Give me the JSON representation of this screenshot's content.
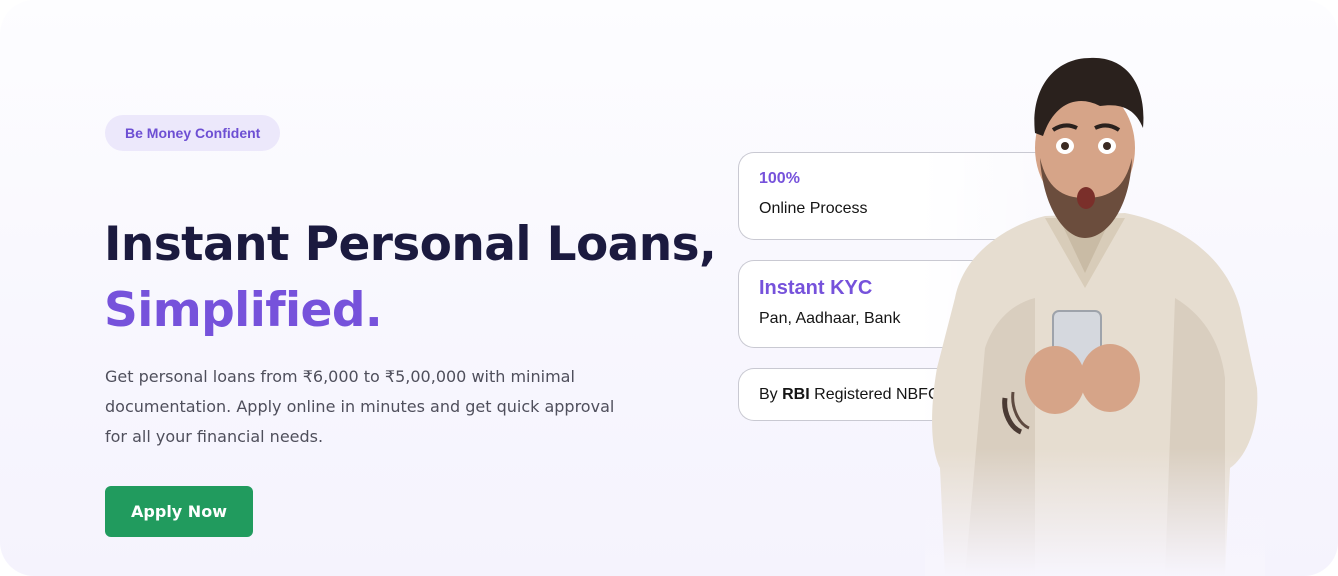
{
  "hero": {
    "badge": "Be Money Confident",
    "title_line1": "Instant Personal Loans,",
    "title_line2": "Simplified.",
    "description": "Get personal loans from ₹6,000 to ₹5,00,000 with minimal documentation. Apply online in minutes and get quick approval for all your financial needs.",
    "cta_label": "Apply Now"
  },
  "features": {
    "online": {
      "head": "100%",
      "sub": "Online Process"
    },
    "kyc": {
      "head": "Instant KYC",
      "sub": "Pan, Aadhaar, Bank"
    },
    "nbfc": {
      "prefix": "By ",
      "bold": "RBI",
      "suffix": " Registered NBFC"
    }
  },
  "colors": {
    "accent": "#7652db",
    "heading": "#1b1a3f",
    "cta": "#219b5e",
    "badge_bg": "#ece8fb"
  },
  "illustration": {
    "name": "surprised-man-with-phone"
  }
}
